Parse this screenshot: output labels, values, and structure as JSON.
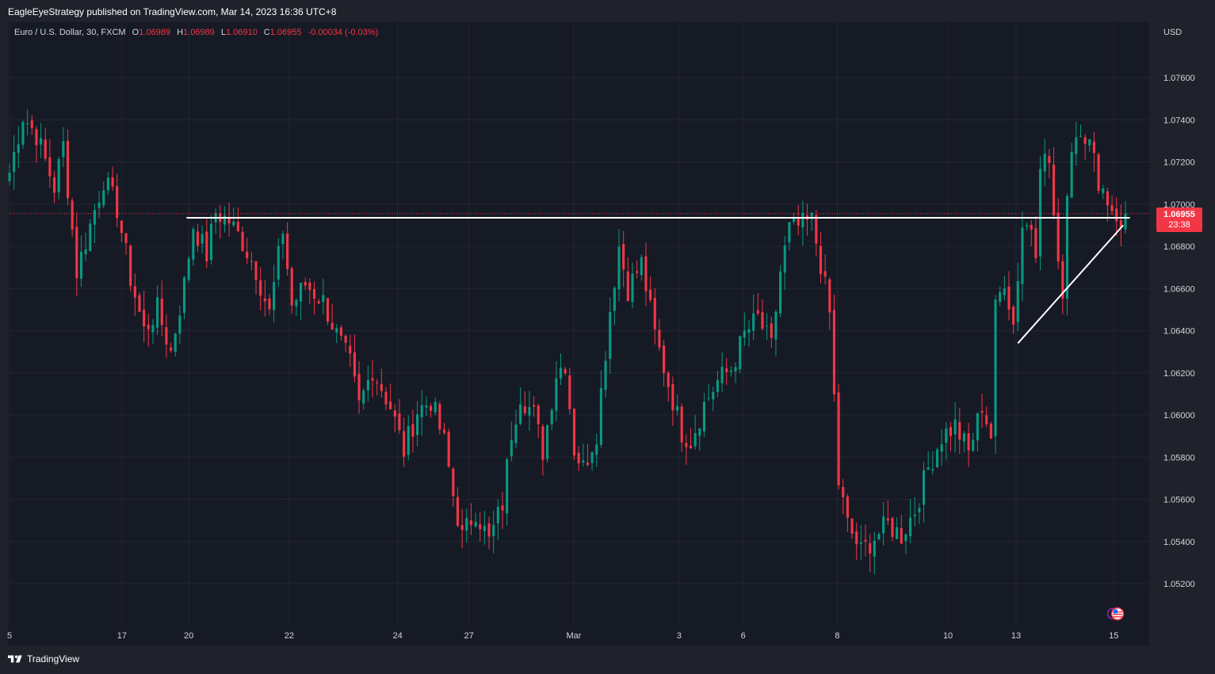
{
  "header": {
    "publisher": "EagleEyeStrategy published on TradingView.com, Mar 14, 2023 16:36 UTC+8"
  },
  "legend": {
    "symbol": "Euro / U.S. Dollar, 30, FXCM",
    "o_label": "O",
    "o": "1.06989",
    "h_label": "H",
    "h": "1.06989",
    "l_label": "L",
    "l": "1.06910",
    "c_label": "C",
    "c": "1.06955",
    "change": "-0.00034 (-0.03%)"
  },
  "currency": "USD",
  "price_badge": {
    "price": "1.06955",
    "countdown": "23:38"
  },
  "footer": {
    "brand": "TradingView"
  },
  "colors": {
    "up": "#089981",
    "down": "#f23645",
    "background": "#161a25",
    "text": "#d1d4dc",
    "drawing": "#ffffff"
  },
  "chart_data": {
    "type": "candlestick",
    "symbol": "EURUSD",
    "timeframe": "30",
    "ylim": [
      1.0508,
      1.0778
    ],
    "y_ticks": [
      "1.05200",
      "1.05400",
      "1.05600",
      "1.05800",
      "1.06000",
      "1.06200",
      "1.06400",
      "1.06600",
      "1.06800",
      "1.07000",
      "1.07200",
      "1.07400",
      "1.07600"
    ],
    "x_ticks": [
      "5",
      "17",
      "20",
      "22",
      "24",
      "27",
      "Mar",
      "3",
      "6",
      "8",
      "10",
      "13",
      "15"
    ],
    "x_tick_pos": [
      0,
      25.1,
      40.0,
      62.4,
      86.6,
      102.5,
      125.9,
      149.4,
      163.7,
      184.7,
      209.4,
      224.6,
      246.4
    ],
    "x_count": 250,
    "last_price": 1.06955,
    "anchors": [
      [
        0,
        1.0715
      ],
      [
        3,
        1.0742
      ],
      [
        6,
        1.0733
      ],
      [
        10,
        1.0708
      ],
      [
        12,
        1.0728
      ],
      [
        15,
        1.0668
      ],
      [
        18,
        1.069
      ],
      [
        21,
        1.0712
      ],
      [
        24,
        1.0698
      ],
      [
        27,
        1.0665
      ],
      [
        30,
        1.064
      ],
      [
        33,
        1.065
      ],
      [
        36,
        1.063
      ],
      [
        39,
        1.0662
      ],
      [
        41,
        1.069
      ],
      [
        44,
        1.0676
      ],
      [
        46,
        1.0696
      ],
      [
        49,
        1.0692
      ],
      [
        52,
        1.0682
      ],
      [
        55,
        1.0669
      ],
      [
        58,
        1.0648
      ],
      [
        61,
        1.0688
      ],
      [
        63,
        1.0652
      ],
      [
        66,
        1.0662
      ],
      [
        70,
        1.0654
      ],
      [
        73,
        1.0638
      ],
      [
        76,
        1.0624
      ],
      [
        78,
        1.0604
      ],
      [
        81,
        1.0622
      ],
      [
        85,
        1.0604
      ],
      [
        88,
        1.0583
      ],
      [
        91,
        1.0602
      ],
      [
        94,
        1.0607
      ],
      [
        97,
        1.0587
      ],
      [
        99,
        1.0562
      ],
      [
        101,
        1.0542
      ],
      [
        104,
        1.0555
      ],
      [
        107,
        1.054
      ],
      [
        110,
        1.0558
      ],
      [
        112,
        1.0592
      ],
      [
        114,
        1.061
      ],
      [
        117,
        1.06
      ],
      [
        119,
        1.0583
      ],
      [
        122,
        1.062
      ],
      [
        124,
        1.0625
      ],
      [
        126,
        1.0584
      ],
      [
        128,
        1.0575
      ],
      [
        131,
        1.0592
      ],
      [
        134,
        1.065
      ],
      [
        136,
        1.068
      ],
      [
        138,
        1.066
      ],
      [
        141,
        1.0672
      ],
      [
        144,
        1.0638
      ],
      [
        147,
        1.0615
      ],
      [
        150,
        1.0592
      ],
      [
        152,
        1.0588
      ],
      [
        155,
        1.0605
      ],
      [
        158,
        1.0616
      ],
      [
        161,
        1.0622
      ],
      [
        164,
        1.0638
      ],
      [
        167,
        1.0646
      ],
      [
        170,
        1.0632
      ],
      [
        172,
        1.0668
      ],
      [
        174,
        1.0688
      ],
      [
        177,
        1.069
      ],
      [
        179,
        1.0692
      ],
      [
        181,
        1.0672
      ],
      [
        183,
        1.0648
      ],
      [
        185,
        1.0568
      ],
      [
        187,
        1.0548
      ],
      [
        190,
        1.0535
      ],
      [
        193,
        1.0542
      ],
      [
        196,
        1.0548
      ],
      [
        199,
        1.0543
      ],
      [
        202,
        1.0555
      ],
      [
        205,
        1.0575
      ],
      [
        208,
        1.059
      ],
      [
        211,
        1.0595
      ],
      [
        214,
        1.0582
      ],
      [
        216,
        1.0597
      ],
      [
        217,
        1.0605
      ],
      [
        219,
        1.059
      ],
      [
        220,
        1.065
      ],
      [
        222,
        1.0665
      ],
      [
        224,
        1.0643
      ],
      [
        226,
        1.069
      ],
      [
        228,
        1.069
      ],
      [
        229,
        1.068
      ],
      [
        230,
        1.0722
      ],
      [
        232,
        1.072
      ],
      [
        234,
        1.0668
      ],
      [
        235,
        1.066
      ],
      [
        236,
        1.0705
      ],
      [
        237,
        1.0728
      ],
      [
        239,
        1.0738
      ],
      [
        241,
        1.0728
      ],
      [
        243,
        1.0712
      ],
      [
        245,
        1.0702
      ],
      [
        247,
        1.0695
      ],
      [
        248,
        1.0686
      ],
      [
        249,
        1.06955
      ]
    ],
    "drawings": [
      {
        "type": "horizontal-line",
        "price": 1.06935,
        "from": 39.5,
        "to": 250
      },
      {
        "type": "trend-line",
        "from": [
          225,
          1.0634
        ],
        "to": [
          248.5,
          1.069
        ]
      }
    ]
  }
}
